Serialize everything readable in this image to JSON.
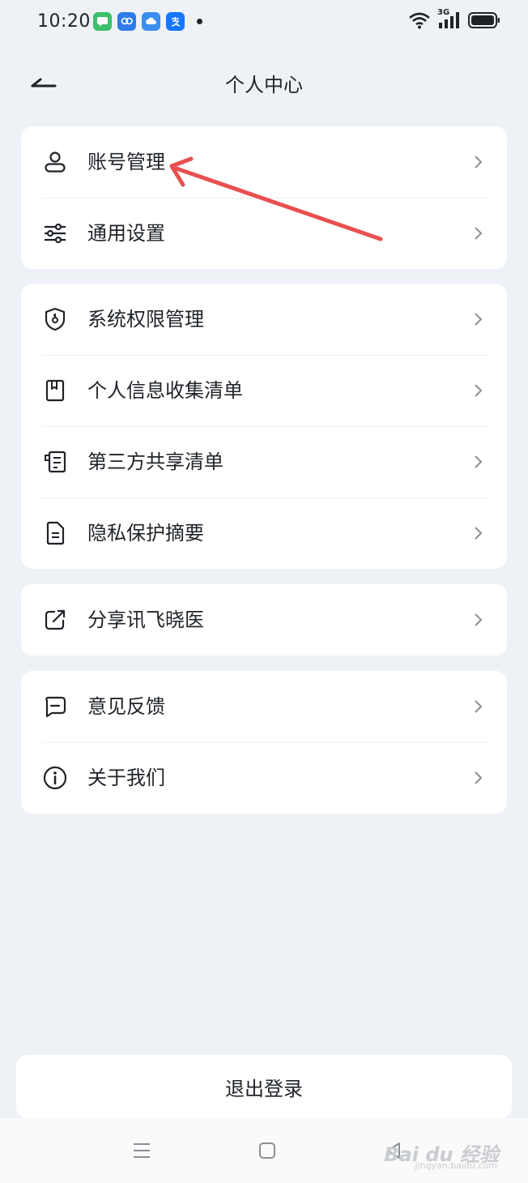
{
  "status_bar": {
    "time": "10:20",
    "network": "3G"
  },
  "header": {
    "title": "个人中心"
  },
  "groups": [
    {
      "items": [
        {
          "icon": "user-icon",
          "label": "账号管理"
        },
        {
          "icon": "sliders-icon",
          "label": "通用设置"
        }
      ]
    },
    {
      "items": [
        {
          "icon": "shield-icon",
          "label": "系统权限管理"
        },
        {
          "icon": "bookmark-doc-icon",
          "label": "个人信息收集清单"
        },
        {
          "icon": "share-list-icon",
          "label": "第三方共享清单"
        },
        {
          "icon": "document-icon",
          "label": "隐私保护摘要"
        }
      ]
    },
    {
      "items": [
        {
          "icon": "share-icon",
          "label": "分享讯飞晓医"
        }
      ]
    },
    {
      "items": [
        {
          "icon": "feedback-icon",
          "label": "意见反馈"
        },
        {
          "icon": "info-icon",
          "label": "关于我们"
        }
      ]
    }
  ],
  "logout": {
    "label": "退出登录"
  },
  "watermark": {
    "brand": "Bai du 经验",
    "url": "jingyan.baidu.com"
  },
  "colors": {
    "background": "#eef2f6",
    "card": "#ffffff",
    "annotation_arrow": "#e8504f"
  }
}
